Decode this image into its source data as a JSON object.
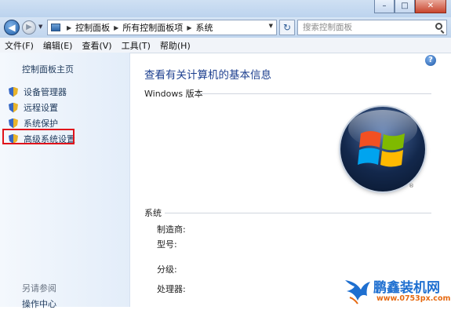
{
  "window": {
    "minimize": "–",
    "maximize": "□",
    "close": "✕"
  },
  "nav": {
    "back": "◀",
    "forward": "▶",
    "breadcrumb": [
      "控制面板",
      "所有控制面板项",
      "系统"
    ],
    "refresh": "↻",
    "search_placeholder": "搜索控制面板"
  },
  "menu": [
    "文件(F)",
    "编辑(E)",
    "查看(V)",
    "工具(T)",
    "帮助(H)"
  ],
  "sidebar": {
    "home": "控制面板主页",
    "links": [
      "设备管理器",
      "远程设置",
      "系统保护",
      "高级系统设置"
    ],
    "highlighted_index": 3,
    "see_also": "另请参阅",
    "action_center": "操作中心"
  },
  "main": {
    "help": "?",
    "title": "查看有关计算机的基本信息",
    "windows_edition_label": "Windows 版本",
    "system_label": "系统",
    "fields": [
      "制造商:",
      "型号:",
      "分级:",
      "处理器:"
    ],
    "logo_tm": "®"
  },
  "watermark": {
    "title": "鹏鑫装机网",
    "url": "www.0753px.com"
  },
  "colors": {
    "highlight_border": "#e0131b",
    "title_blue": "#1c3f8f",
    "link_blue": "#1e395b"
  }
}
